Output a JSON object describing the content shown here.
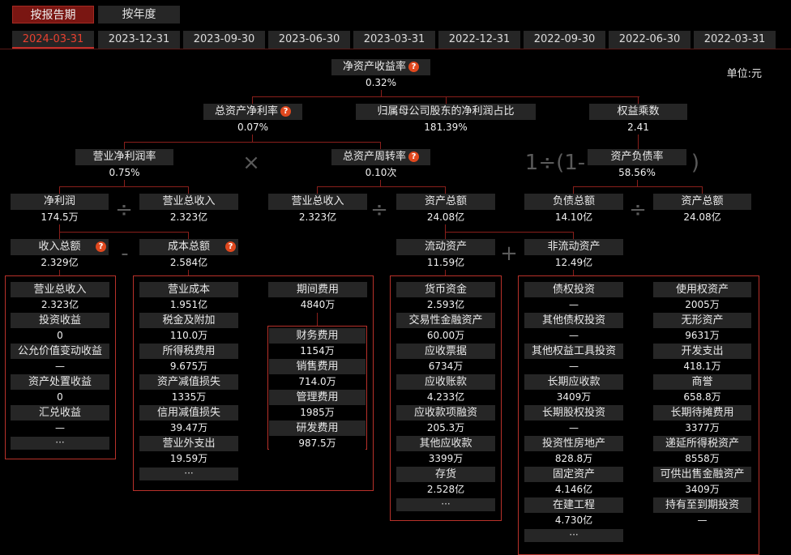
{
  "tabs": [
    {
      "label": "按报告期",
      "selected": true
    },
    {
      "label": "按年度",
      "selected": false
    }
  ],
  "dates": [
    "2024-03-31",
    "2023-12-31",
    "2023-09-30",
    "2023-06-30",
    "2023-03-31",
    "2022-12-31",
    "2022-09-30",
    "2022-06-30",
    "2022-03-31"
  ],
  "unit": "单位:元",
  "help": "?",
  "ops": {
    "times": "×",
    "div": "÷",
    "minus": "-",
    "plus": "+",
    "eq_prefix": "1÷(1-",
    "eq_suffix": ")"
  },
  "nodes": {
    "roe": {
      "label": "净资产收益率",
      "value": "0.32%"
    },
    "roa": {
      "label": "总资产净利率",
      "value": "0.07%"
    },
    "parent_ratio": {
      "label": "归属母公司股东的净利润占比",
      "value": "181.39%"
    },
    "equity_mult": {
      "label": "权益乘数",
      "value": "2.41"
    },
    "net_margin": {
      "label": "营业净利润率",
      "value": "0.75%"
    },
    "turnover": {
      "label": "总资产周转率",
      "value": "0.10次"
    },
    "debt_ratio": {
      "label": "资产负债率",
      "value": "58.56%"
    },
    "net_profit": {
      "label": "净利润",
      "value": "174.5万"
    },
    "revenue1": {
      "label": "营业总收入",
      "value": "2.323亿"
    },
    "revenue2": {
      "label": "营业总收入",
      "value": "2.323亿"
    },
    "assets1": {
      "label": "资产总额",
      "value": "24.08亿"
    },
    "liab": {
      "label": "负债总额",
      "value": "14.10亿"
    },
    "assets2": {
      "label": "资产总额",
      "value": "24.08亿"
    },
    "income_total": {
      "label": "收入总额",
      "value": "2.329亿"
    },
    "cost_total": {
      "label": "成本总额",
      "value": "2.584亿"
    },
    "cur_assets": {
      "label": "流动资产",
      "value": "11.59亿"
    },
    "noncur_assets": {
      "label": "非流动资产",
      "value": "12.49亿"
    }
  },
  "income_items": [
    {
      "label": "营业总收入",
      "value": "2.323亿"
    },
    {
      "label": "投资收益",
      "value": "0"
    },
    {
      "label": "公允价值变动收益",
      "value": "—"
    },
    {
      "label": "资产处置收益",
      "value": "0"
    },
    {
      "label": "汇兑收益",
      "value": "—"
    }
  ],
  "cost_items": [
    {
      "label": "营业成本",
      "value": "1.951亿"
    },
    {
      "label": "税金及附加",
      "value": "110.0万"
    },
    {
      "label": "所得税费用",
      "value": "9.675万"
    },
    {
      "label": "资产减值损失",
      "value": "1335万"
    },
    {
      "label": "信用减值损失",
      "value": "39.47万"
    },
    {
      "label": "营业外支出",
      "value": "19.59万"
    }
  ],
  "period_expense": {
    "label": "期间费用",
    "value": "4840万"
  },
  "expense_items": [
    {
      "label": "财务费用",
      "value": "1154万"
    },
    {
      "label": "销售费用",
      "value": "714.0万"
    },
    {
      "label": "管理费用",
      "value": "1985万"
    },
    {
      "label": "研发费用",
      "value": "987.5万"
    }
  ],
  "cur_items": [
    {
      "label": "货币资金",
      "value": "2.593亿"
    },
    {
      "label": "交易性金融资产",
      "value": "60.00万"
    },
    {
      "label": "应收票据",
      "value": "6734万"
    },
    {
      "label": "应收账款",
      "value": "4.233亿"
    },
    {
      "label": "应收款项融资",
      "value": "205.3万"
    },
    {
      "label": "其他应收款",
      "value": "3399万"
    },
    {
      "label": "存货",
      "value": "2.528亿"
    }
  ],
  "noncur_left": [
    {
      "label": "债权投资",
      "value": "—"
    },
    {
      "label": "其他债权投资",
      "value": "—"
    },
    {
      "label": "其他权益工具投资",
      "value": "—"
    },
    {
      "label": "长期应收款",
      "value": "3409万"
    },
    {
      "label": "长期股权投资",
      "value": "—"
    },
    {
      "label": "投资性房地产",
      "value": "828.8万"
    },
    {
      "label": "固定资产",
      "value": "4.146亿"
    },
    {
      "label": "在建工程",
      "value": "4.730亿"
    }
  ],
  "noncur_right": [
    {
      "label": "使用权资产",
      "value": "2005万"
    },
    {
      "label": "无形资产",
      "value": "9631万"
    },
    {
      "label": "开发支出",
      "value": "418.1万"
    },
    {
      "label": "商誉",
      "value": "658.8万"
    },
    {
      "label": "长期待摊费用",
      "value": "3377万"
    },
    {
      "label": "递延所得税资产",
      "value": "8558万"
    },
    {
      "label": "可供出售金融资产",
      "value": "3409万"
    },
    {
      "label": "持有至到期投资",
      "value": "—"
    }
  ],
  "more": "···"
}
